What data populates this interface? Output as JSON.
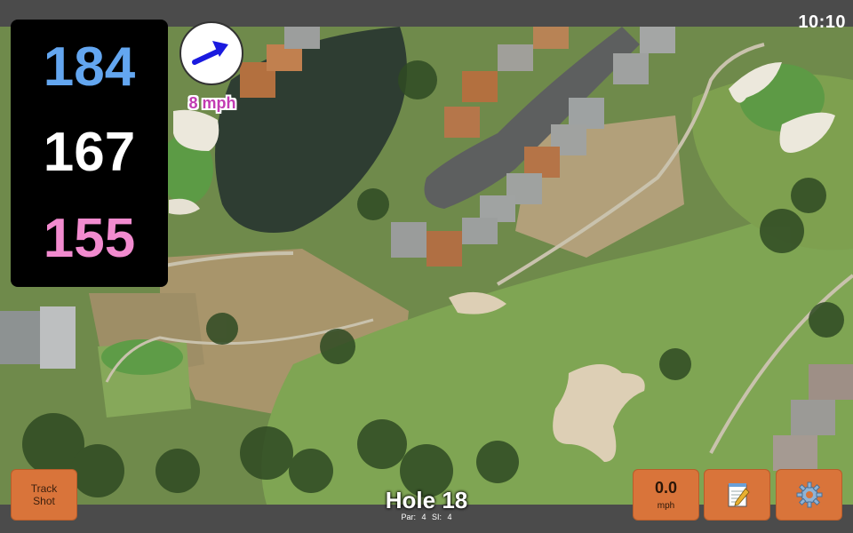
{
  "clock": "10:10",
  "distances": {
    "back": "184",
    "middle": "167",
    "front": "155"
  },
  "wind": {
    "speed_text": "8 mph",
    "direction_icon": "wind-arrow-icon"
  },
  "buttons": {
    "track_shot": "Track Shot",
    "speed_value": "0.0",
    "speed_unit": "mph",
    "notes_icon": "notepad-icon",
    "settings_icon": "gear-icon"
  },
  "hole": {
    "title": "Hole 18",
    "info": "Par: 4   SI: 4"
  },
  "colors": {
    "back_distance": "#63a6f0",
    "middle_distance": "#ffffff",
    "front_distance": "#f28bcf",
    "button_orange": "#d9743a",
    "wind_text": "#c23cb3"
  }
}
